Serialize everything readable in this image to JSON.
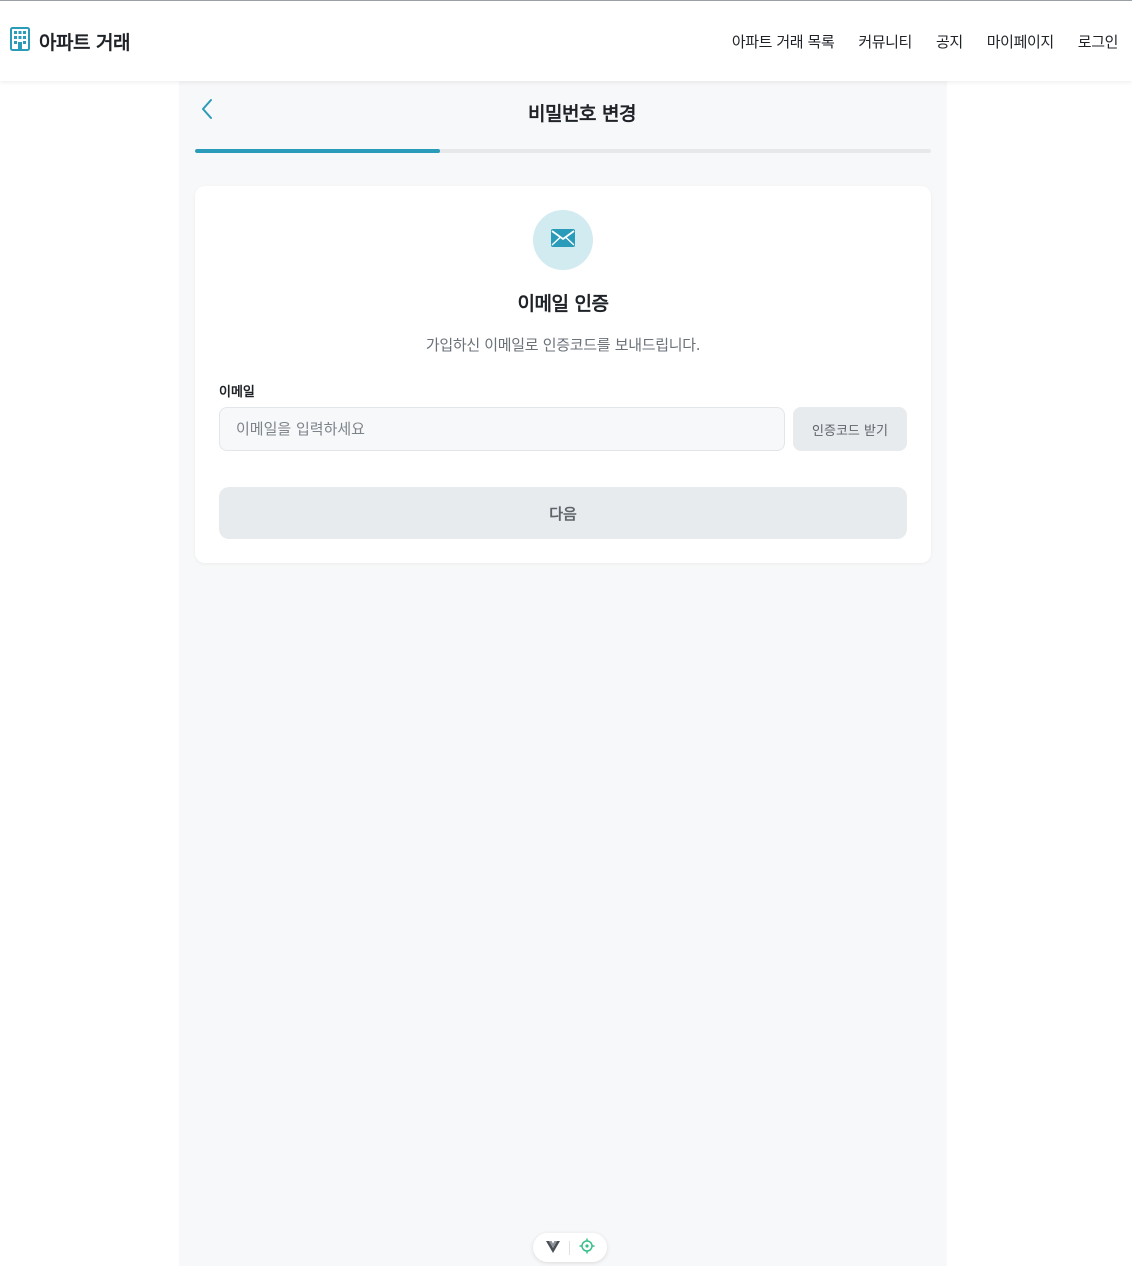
{
  "brand": {
    "name": "아파트 거래",
    "icon": "building-icon"
  },
  "nav": {
    "items": [
      {
        "label": "아파트 거래 목록"
      },
      {
        "label": "커뮤니티"
      },
      {
        "label": "공지"
      },
      {
        "label": "마이페이지"
      },
      {
        "label": "로그인"
      }
    ]
  },
  "page": {
    "title": "비밀번호 변경",
    "back_icon": "chevron-left-icon",
    "progress_fraction": 0.3333
  },
  "card": {
    "icon": "mail-icon",
    "title": "이메일 인증",
    "description": "가입하신 이메일로 인증코드를 보내드립니다.",
    "email_label": "이메일",
    "email_value": "",
    "email_placeholder": "이메일을 입력하세요",
    "code_button_label": "인증코드 받기",
    "next_button_label": "다음"
  },
  "devtools": {
    "icons": [
      "vue-logo-icon",
      "target-icon"
    ]
  },
  "colors": {
    "accent": "#2a9bb8",
    "panel_bg": "#f7f8f9",
    "icon_circle_bg": "#d2ebf0",
    "disabled_button_bg": "#e8ebed"
  }
}
